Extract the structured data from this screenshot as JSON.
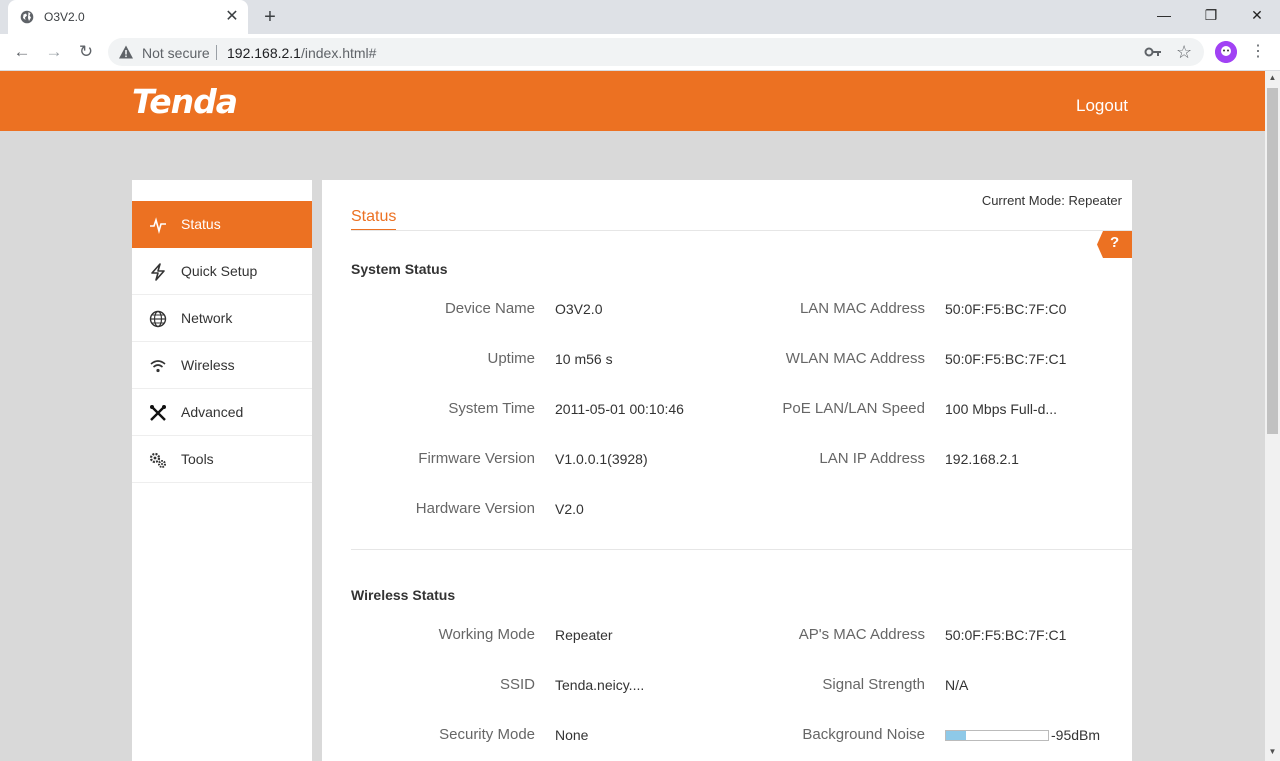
{
  "browser": {
    "tab_title": "O3V2.0",
    "tab_close": "✕",
    "new_tab": "+",
    "window_controls": {
      "minimize": "—",
      "restore": "❐",
      "close": "✕"
    },
    "nav": {
      "back": "←",
      "forward": "→",
      "reload": "↻"
    },
    "not_secure": "Not secure",
    "url_host": "192.168.2.1",
    "url_path": "/index.html#",
    "star": "☆",
    "menu": "⋮"
  },
  "header": {
    "logo": "Tenda",
    "logout": "Logout",
    "accent_color": "#ec7122"
  },
  "sidebar": {
    "items": [
      {
        "label": "Status",
        "icon": "pulse-icon",
        "active": true
      },
      {
        "label": "Quick Setup",
        "icon": "bolt-icon",
        "active": false
      },
      {
        "label": "Network",
        "icon": "globe-icon",
        "active": false
      },
      {
        "label": "Wireless",
        "icon": "wifi-icon",
        "active": false
      },
      {
        "label": "Advanced",
        "icon": "tools-icon",
        "active": false
      },
      {
        "label": "Tools",
        "icon": "gears-icon",
        "active": false
      }
    ]
  },
  "content": {
    "current_mode": "Current Mode: Repeater",
    "title": "Status",
    "help": "?",
    "system_status": {
      "title": "System Status",
      "rows": [
        {
          "label": "Device Name",
          "value": "O3V2.0"
        },
        {
          "label": "Uptime",
          "value": "10 m56 s"
        },
        {
          "label": "System Time",
          "value": "2011-05-01 00:10:46"
        },
        {
          "label": "Firmware Version",
          "value": "V1.0.0.1(3928)"
        },
        {
          "label": "Hardware Version",
          "value": "V2.0"
        }
      ],
      "rows_right": [
        {
          "label": "LAN MAC Address",
          "value": "50:0F:F5:BC:7F:C0"
        },
        {
          "label": "WLAN MAC Address",
          "value": "50:0F:F5:BC:7F:C1"
        },
        {
          "label": "PoE LAN/LAN Speed",
          "value": "100 Mbps Full-d..."
        },
        {
          "label": "LAN IP Address",
          "value": "192.168.2.1"
        }
      ]
    },
    "wireless_status": {
      "title": "Wireless Status",
      "rows": [
        {
          "label": "Working Mode",
          "value": "Repeater"
        },
        {
          "label": "SSID",
          "value": "Tenda.neicy...."
        },
        {
          "label": "Security Mode",
          "value": "None"
        }
      ],
      "rows_right": [
        {
          "label": "AP's MAC Address",
          "value": "50:0F:F5:BC:7F:C1"
        },
        {
          "label": "Signal Strength",
          "value": "N/A"
        },
        {
          "label": "Background Noise",
          "value": "-95dBm"
        }
      ],
      "background_noise_level": 0.2
    }
  }
}
